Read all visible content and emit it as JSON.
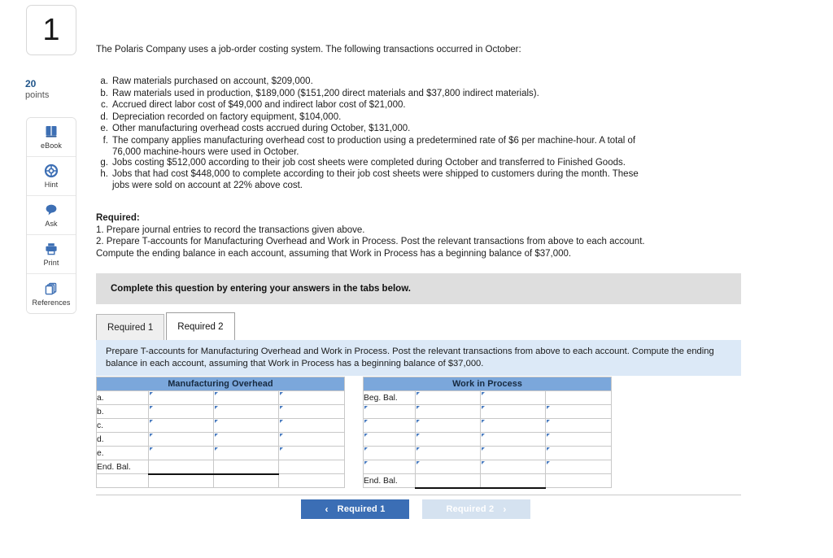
{
  "question": {
    "number": "1",
    "points_value": "20",
    "points_label": "points"
  },
  "tools": [
    {
      "label": "eBook",
      "icon": "book-icon"
    },
    {
      "label": "Hint",
      "icon": "life-ring-icon"
    },
    {
      "label": "Ask",
      "icon": "speech-bubble-icon"
    },
    {
      "label": "Print",
      "icon": "printer-icon"
    },
    {
      "label": "References",
      "icon": "pages-stack-icon"
    }
  ],
  "problem": {
    "intro": "The Polaris Company uses a job-order costing system. The following transactions occurred in October:",
    "transactions": [
      {
        "letter": "a.",
        "text": "Raw materials purchased on account, $209,000.",
        "cont": ""
      },
      {
        "letter": "b.",
        "text": "Raw materials used in production, $189,000 ($151,200 direct materials and $37,800 indirect materials).",
        "cont": ""
      },
      {
        "letter": "c.",
        "text": "Accrued direct labor cost of $49,000 and indirect labor cost of $21,000.",
        "cont": ""
      },
      {
        "letter": "d.",
        "text": "Depreciation recorded on factory equipment, $104,000.",
        "cont": ""
      },
      {
        "letter": "e.",
        "text": "Other manufacturing overhead costs accrued during October, $131,000.",
        "cont": ""
      },
      {
        "letter": "f.",
        "text": "The company applies manufacturing overhead cost to production using a predetermined rate of $6 per machine-hour. A total of",
        "cont": "76,000 machine-hours were used in October."
      },
      {
        "letter": "g.",
        "text": "Jobs costing $512,000 according to their job cost sheets were completed during October and transferred to Finished Goods.",
        "cont": ""
      },
      {
        "letter": "h.",
        "text": "Jobs that had cost $448,000 to complete according to their job cost sheets were shipped to customers during the month. These",
        "cont": "jobs were sold on account at 22% above cost."
      }
    ],
    "required_heading": "Required:",
    "required_items": [
      "1. Prepare journal entries to record the transactions given above.",
      "2. Prepare T-accounts for Manufacturing Overhead and Work in Process. Post the relevant transactions from above to each account.",
      "Compute the ending balance in each account, assuming that Work in Process has a beginning balance of $37,000."
    ]
  },
  "banner": {
    "text": "Complete this question by entering your answers in the tabs below."
  },
  "tabs": [
    {
      "label": "Required 1",
      "active": false
    },
    {
      "label": "Required 2",
      "active": true
    }
  ],
  "instruction": {
    "text": "Prepare T-accounts for Manufacturing Overhead and Work in Process. Post the relevant transactions from above to each account. Compute the ending balance in each account, assuming that Work in Process has a beginning balance of $37,000."
  },
  "t_accounts": [
    {
      "title": "Manufacturing Overhead",
      "rows": [
        {
          "label": "a.",
          "cells": [
            "input",
            "input",
            "input"
          ]
        },
        {
          "label": "b.",
          "cells": [
            "input",
            "input",
            "input"
          ]
        },
        {
          "label": "c.",
          "cells": [
            "input",
            "input",
            "input"
          ]
        },
        {
          "label": "d.",
          "cells": [
            "input",
            "input",
            "input"
          ]
        },
        {
          "label": "e.",
          "cells": [
            "input",
            "input",
            "input"
          ]
        },
        {
          "label": "End. Bal.",
          "cells": [
            "plain",
            "plain",
            "plain"
          ]
        },
        {
          "label": "",
          "cells": [
            "blank",
            "blank",
            "blank"
          ]
        }
      ]
    },
    {
      "title": "Work in Process",
      "rows": [
        {
          "label": "Beg. Bal.",
          "cells": [
            "input",
            "input",
            "plain"
          ]
        },
        {
          "label": "",
          "cells": [
            "input",
            "input",
            "input"
          ]
        },
        {
          "label": "",
          "cells": [
            "input",
            "input",
            "input"
          ]
        },
        {
          "label": "",
          "cells": [
            "input",
            "input",
            "input"
          ]
        },
        {
          "label": "",
          "cells": [
            "input",
            "input",
            "input"
          ]
        },
        {
          "label": "",
          "cells": [
            "input",
            "input",
            "input"
          ]
        },
        {
          "label": "End. Bal.",
          "cells": [
            "plain",
            "plain",
            "plain"
          ]
        }
      ]
    }
  ],
  "footer_nav": {
    "prev": {
      "label": "Required 1",
      "chevron": "‹"
    },
    "next": {
      "label": "Required 2",
      "chevron": "›"
    }
  },
  "colors": {
    "header_blue": "#7ba7db",
    "instruction_blue": "#dce9f7",
    "banner_gray": "#dedede",
    "primary_button": "#3b6eb5",
    "muted_button": "#d5e2f0",
    "points_blue": "#20558a"
  }
}
